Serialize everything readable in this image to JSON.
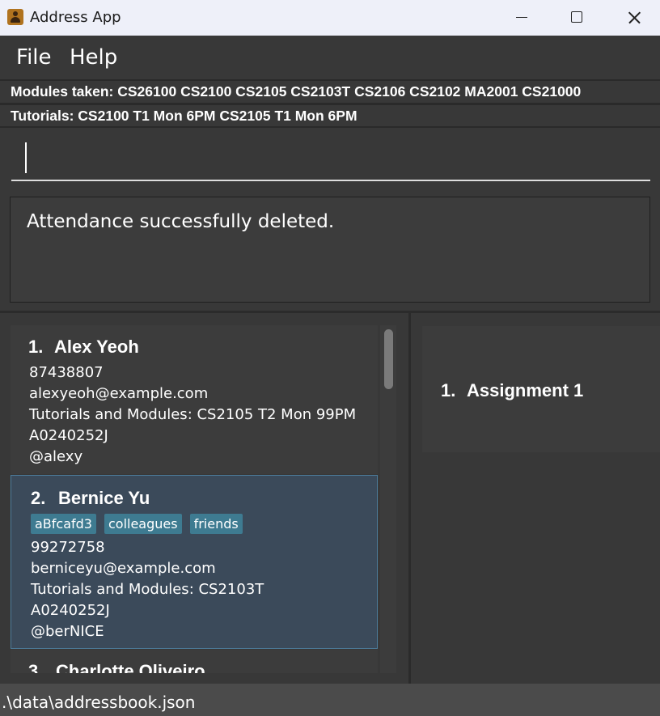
{
  "window": {
    "title": "Address App"
  },
  "menu": {
    "file": "File",
    "help": "Help"
  },
  "info": {
    "modules": "Modules taken: CS26100 CS2100 CS2105 CS2103T CS2106 CS2102 MA2001 CS21000",
    "tutorials": "Tutorials: CS2100 T1 Mon 6PM  CS2105 T1 Mon 6PM"
  },
  "command": {
    "value": ""
  },
  "result": {
    "text": "Attendance successfully deleted."
  },
  "persons": [
    {
      "index": "1.",
      "name": "Alex Yeoh",
      "tags": [],
      "phone": "87438807",
      "email": "alexyeoh@example.com",
      "modules": "Tutorials and Modules: CS2105 T2 Mon 99PM",
      "id": "A0240252J",
      "handle": "@alexy"
    },
    {
      "index": "2.",
      "name": "Bernice Yu",
      "tags": [
        "aBfcafd3",
        "colleagues",
        "friends"
      ],
      "phone": "99272758",
      "email": "berniceyu@example.com",
      "modules": "Tutorials and Modules: CS2103T",
      "id": "A0240252J",
      "handle": "@berNICE"
    },
    {
      "index": "3.",
      "name": "Charlotte Oliveiro"
    }
  ],
  "assignments": [
    {
      "index": "1.",
      "name": "Assignment 1"
    }
  ],
  "status": {
    "path": ".\\data\\addressbook.json"
  }
}
